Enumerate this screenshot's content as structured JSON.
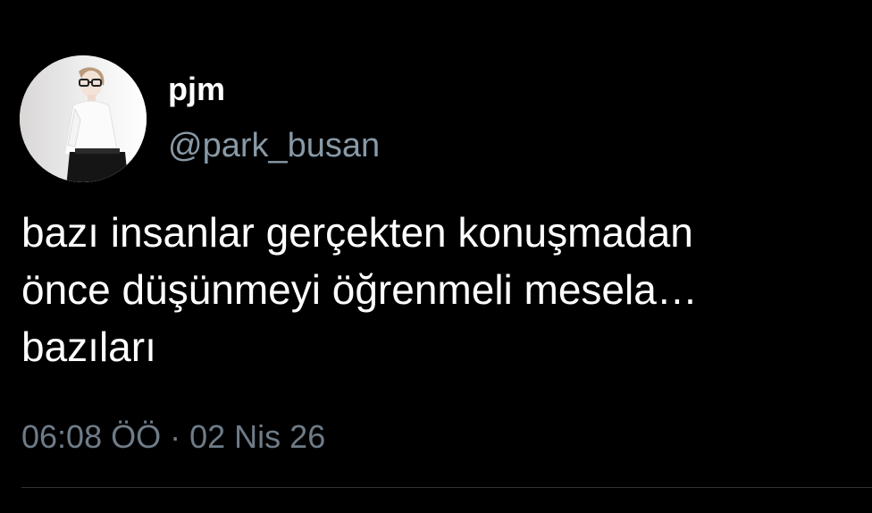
{
  "author": {
    "display_name": "pjm",
    "handle": "@park_busan",
    "avatar_icon": "profile-photo"
  },
  "tweet": {
    "text": "bazı insanlar gerçekten konuşmadan\nönce düşünmeyi öğrenmeli mesela…\nbazıları",
    "time": "06:08 ÖÖ",
    "separator": "·",
    "date": "02 Nis 26"
  },
  "colors": {
    "background": "#000000",
    "text": "#ffffff",
    "muted": "#8899a6"
  }
}
